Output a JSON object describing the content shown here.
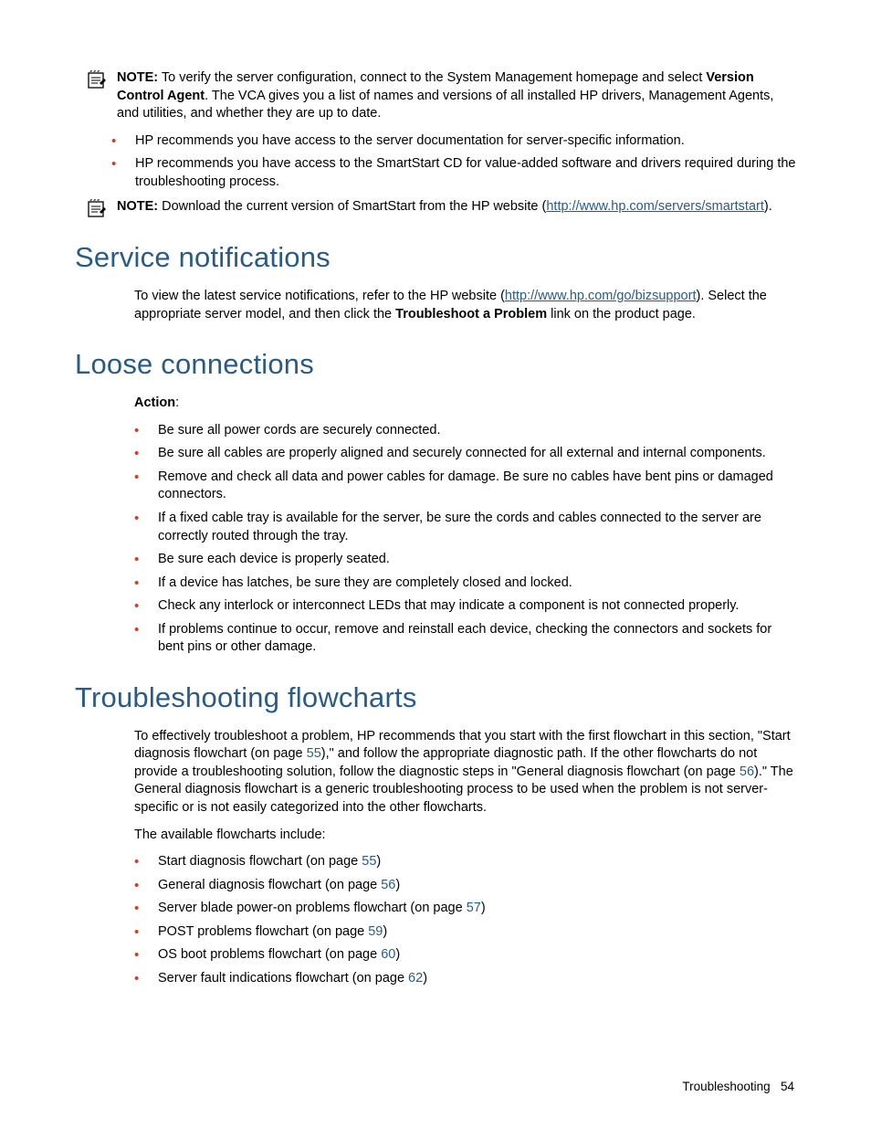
{
  "note1": {
    "label": "NOTE:",
    "text1": "To verify the server configuration, connect to the System Management homepage and select ",
    "bold": "Version Control Agent",
    "text2": ". The VCA gives you a list of names and versions of all installed HP drivers, Management Agents, and utilities, and whether they are up to date."
  },
  "bullets1": [
    "HP recommends you have access to the server documentation for server-specific information.",
    "HP recommends you have access to the SmartStart CD for value-added software and drivers required during the troubleshooting process."
  ],
  "note2": {
    "label": "NOTE:",
    "text1": "Download the current version of SmartStart from the HP website (",
    "link": "http://www.hp.com/servers/smartstart",
    "text2": ")."
  },
  "section1": {
    "title": "Service notifications",
    "p1a": "To view the latest service notifications, refer to the HP website (",
    "link": "http://www.hp.com/go/bizsupport",
    "p1b": "). Select the appropriate server model, and then click the ",
    "bold": "Troubleshoot a Problem",
    "p1c": " link on the product page."
  },
  "section2": {
    "title": "Loose connections",
    "action": "Action",
    "bullets": [
      "Be sure all power cords are securely connected.",
      "Be sure all cables are properly aligned and securely connected for all external and internal components.",
      "Remove and check all data and power cables for damage. Be sure no cables have bent pins or damaged connectors.",
      "If a fixed cable tray is available for the server, be sure the cords and cables connected to the server are correctly routed through the tray.",
      "Be sure each device is properly seated.",
      "If a device has latches, be sure they are completely closed and locked.",
      "Check any interlock or interconnect LEDs that may indicate a component is not connected properly.",
      "If problems continue to occur, remove and reinstall each device, checking the connectors and sockets for bent pins or other damage."
    ]
  },
  "section3": {
    "title": "Troubleshooting flowcharts",
    "p1a": "To effectively troubleshoot a problem, HP recommends that you start with the first flowchart in this section, \"Start diagnosis flowchart (on page ",
    "ref1": "55",
    "p1b": "),\" and follow the appropriate diagnostic path. If the other flowcharts do not provide a troubleshooting solution, follow the diagnostic steps in \"General diagnosis flowchart (on page ",
    "ref2": "56",
    "p1c": ").\" The General diagnosis flowchart is a generic troubleshooting process to be used when the problem is not server-specific or is not easily categorized into the other flowcharts.",
    "p2": "The available flowcharts include:",
    "bullets": [
      {
        "t1": "Start diagnosis flowchart (on page ",
        "ref": "55",
        "t2": ")"
      },
      {
        "t1": "General diagnosis flowchart (on page ",
        "ref": "56",
        "t2": ")"
      },
      {
        "t1": "Server blade power-on problems flowchart (on page ",
        "ref": "57",
        "t2": ")"
      },
      {
        "t1": "POST problems flowchart (on page ",
        "ref": "59",
        "t2": ")"
      },
      {
        "t1": "OS boot problems flowchart (on page ",
        "ref": "60",
        "t2": ")"
      },
      {
        "t1": "Server fault indications flowchart (on page ",
        "ref": "62",
        "t2": ")"
      }
    ]
  },
  "footer": {
    "section": "Troubleshooting",
    "page": "54"
  }
}
